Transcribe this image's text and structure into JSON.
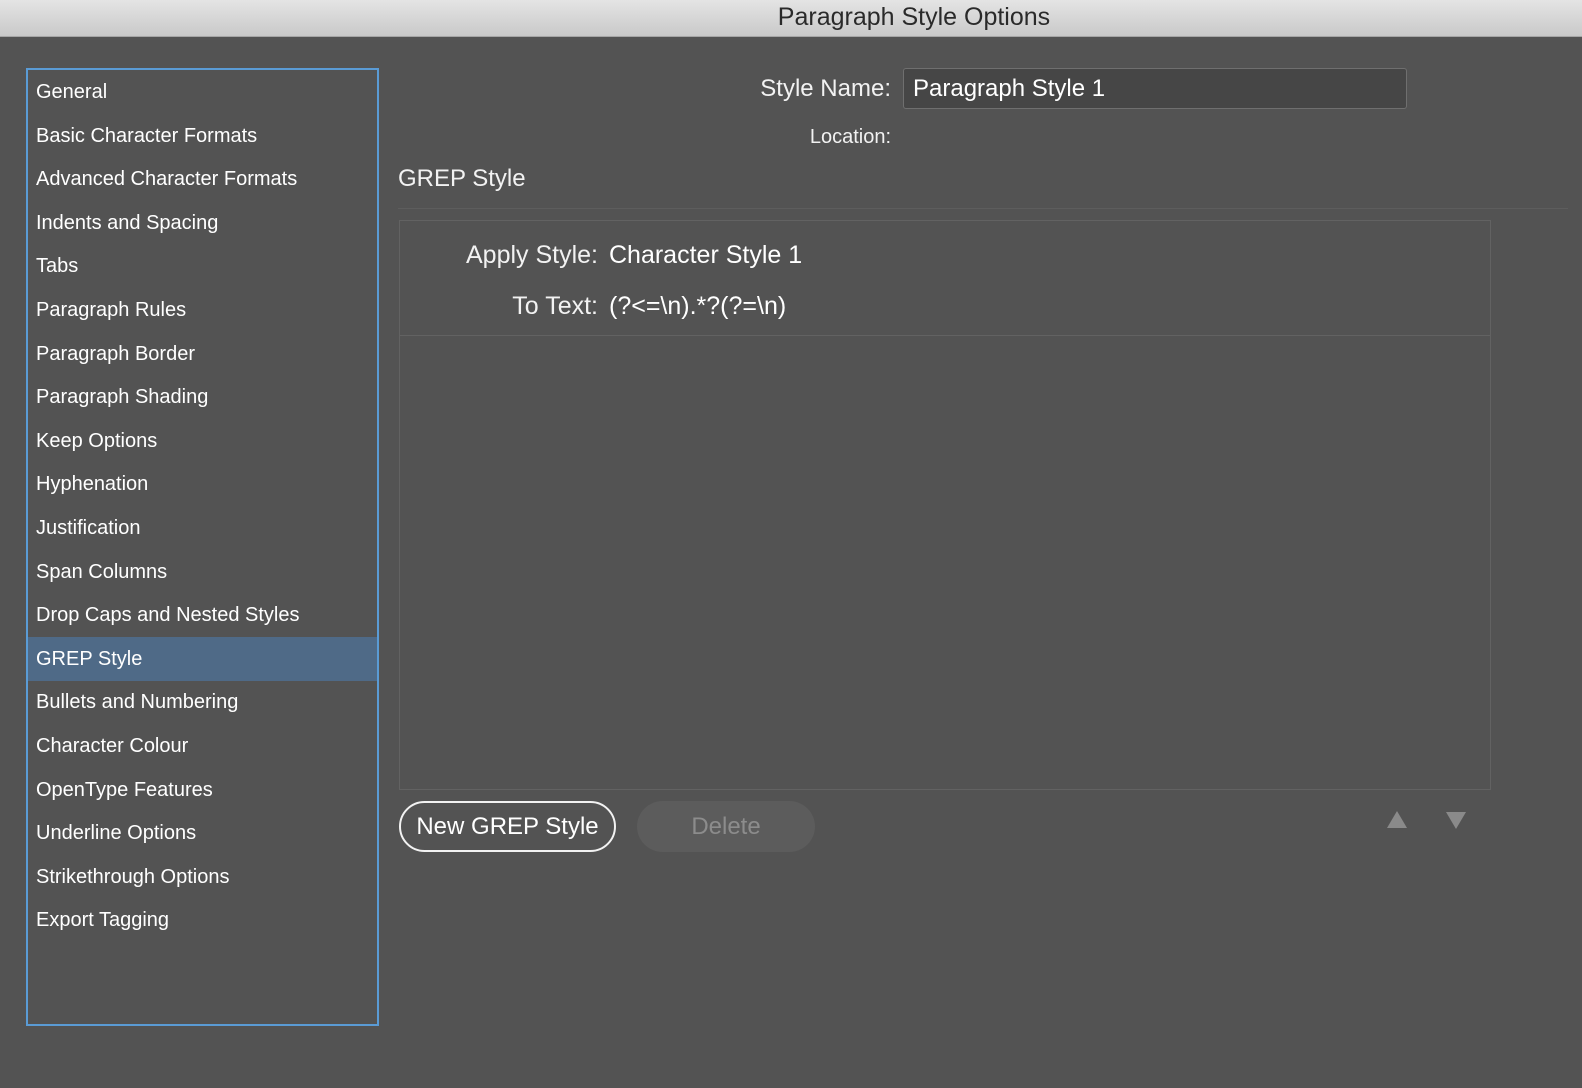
{
  "window": {
    "title": "Paragraph Style Options"
  },
  "sidebar": {
    "selected_index": 13,
    "items": [
      {
        "label": "General"
      },
      {
        "label": "Basic Character Formats"
      },
      {
        "label": "Advanced Character Formats"
      },
      {
        "label": "Indents and Spacing"
      },
      {
        "label": "Tabs"
      },
      {
        "label": "Paragraph Rules"
      },
      {
        "label": "Paragraph Border"
      },
      {
        "label": "Paragraph Shading"
      },
      {
        "label": "Keep Options"
      },
      {
        "label": "Hyphenation"
      },
      {
        "label": "Justification"
      },
      {
        "label": "Span Columns"
      },
      {
        "label": "Drop Caps and Nested Styles"
      },
      {
        "label": "GREP Style"
      },
      {
        "label": "Bullets and Numbering"
      },
      {
        "label": "Character Colour"
      },
      {
        "label": "OpenType Features"
      },
      {
        "label": "Underline Options"
      },
      {
        "label": "Strikethrough Options"
      },
      {
        "label": "Export Tagging"
      }
    ]
  },
  "header": {
    "style_name_label": "Style Name:",
    "style_name_value": "Paragraph Style 1",
    "location_label": "Location:"
  },
  "section": {
    "title": "GREP Style"
  },
  "grep_styles": [
    {
      "apply_style_label": "Apply Style:",
      "apply_style_value": "Character Style 1",
      "to_text_label": "To Text:",
      "to_text_value": "(?<=\\n).*?(?=\\n)"
    }
  ],
  "buttons": {
    "new_label": "New GREP Style",
    "delete_label": "Delete",
    "move_up_icon": "triangle-up-icon",
    "move_down_icon": "triangle-down-icon"
  },
  "colors": {
    "panel_bg": "#535353",
    "selection_bg": "#4f6a87",
    "focus_border": "#5a9bd5"
  }
}
